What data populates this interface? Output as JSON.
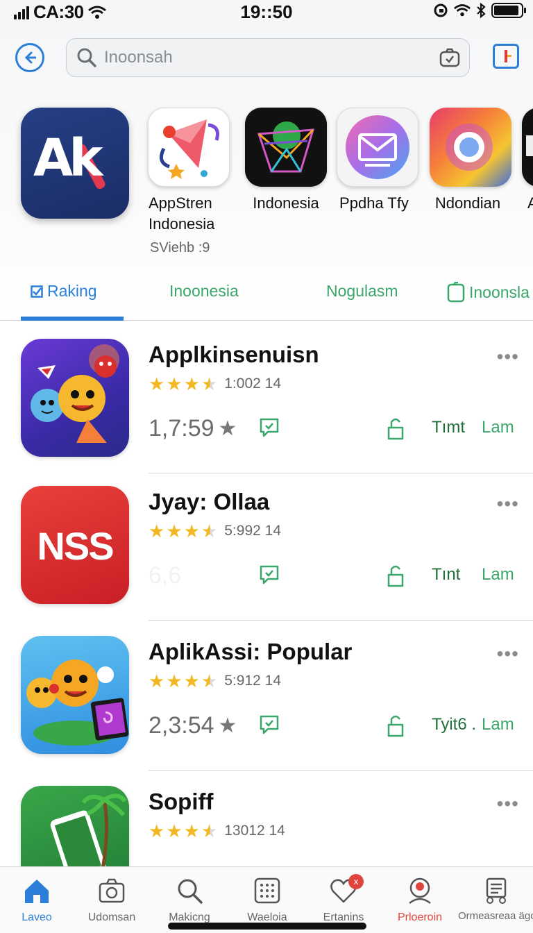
{
  "status_bar": {
    "carrier": "CA:30",
    "time": "19::50"
  },
  "search": {
    "placeholder": "Inoonsah"
  },
  "featured": {
    "main_logo": "Ak",
    "items": [
      {
        "label": "AppStren Indonesia",
        "line1": "AppStren",
        "line2": "Indonesia",
        "icon": "kite-icon"
      },
      {
        "label": "Indonesia",
        "icon": "envelope-3d-icon"
      },
      {
        "label": "Ppdha Tfy",
        "icon": "mail-icon"
      },
      {
        "label": "Ndondian",
        "icon": "chrome-icon"
      },
      {
        "label": "A",
        "icon": "partial-app-icon"
      }
    ],
    "subtitle": "SViehb :9"
  },
  "tabs": [
    {
      "label": "Raking",
      "active": true
    },
    {
      "label": "Inoonesia"
    },
    {
      "label": "Nogulasm"
    },
    {
      "label": "Inoonsla"
    }
  ],
  "apps": [
    {
      "name": "Applkinsenuisn",
      "rating_text": "1:002  14",
      "metric": "1,7:59",
      "action1": "Tımt",
      "action2": "Lam",
      "more": "•••",
      "icon": "game-characters-icon"
    },
    {
      "name": "Jyay: Ollaa",
      "rating_text": "5:992  14",
      "metric": "6,6",
      "action1": "Tınt",
      "action2": "Lam",
      "more": "•••",
      "icon": "nss-logo-icon"
    },
    {
      "name": "AplikAssi: Popular",
      "rating_text": "5:912  14",
      "metric": "2,3:54",
      "action1": "Tyit6 .",
      "action2": "Lam",
      "more": "•••",
      "icon": "emoji-characters-icon"
    },
    {
      "name": "Sopiff",
      "rating_text": "13012  14",
      "more": "•••",
      "icon": "phone-palm-icon"
    }
  ],
  "bottom_nav": [
    {
      "label": "Laveo",
      "icon": "home-icon",
      "state": "active"
    },
    {
      "label": "Udomsan",
      "icon": "camera-icon"
    },
    {
      "label": "Makicng",
      "icon": "search-icon"
    },
    {
      "label": "Waeloia",
      "icon": "grid-icon"
    },
    {
      "label": "Ertanins",
      "icon": "heart-icon",
      "badge": "x"
    },
    {
      "label": "Prloeroin",
      "icon": "profile-icon",
      "state": "red"
    },
    {
      "label": "Ormeasreaa ägo",
      "icon": "list-icon"
    }
  ],
  "colors": {
    "accent_blue": "#2b7fd9",
    "tab_green": "#3aa66b",
    "star_yellow": "#f2b824",
    "badge_red": "#e0453d"
  }
}
